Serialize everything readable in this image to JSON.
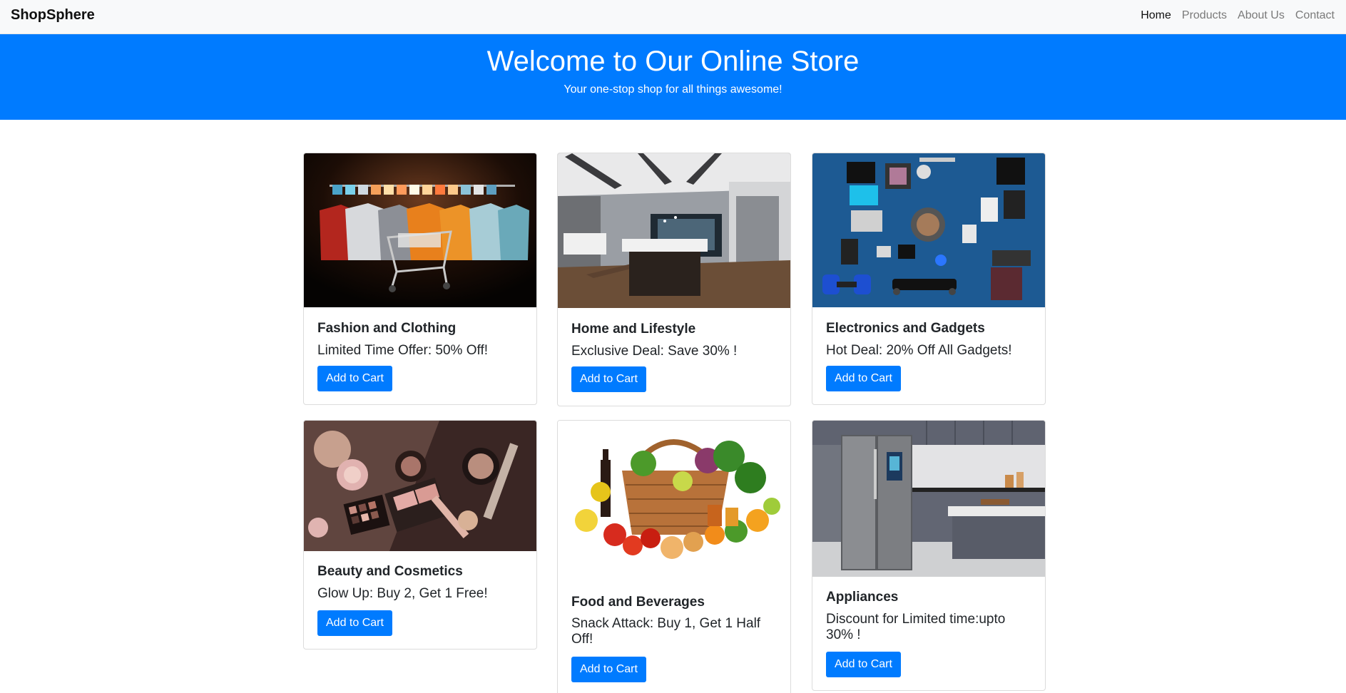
{
  "nav": {
    "brand": "ShopSphere",
    "links": [
      {
        "label": "Home",
        "active": true
      },
      {
        "label": "Products",
        "active": false
      },
      {
        "label": "About Us",
        "active": false
      },
      {
        "label": "Contact",
        "active": false
      }
    ]
  },
  "hero": {
    "title": "Welcome to Our Online Store",
    "subtitle": "Your one-stop shop for all things awesome!"
  },
  "products": [
    {
      "title": "Fashion and Clothing",
      "offer": "Limited Time Offer: 50% Off!",
      "button": "Add to Cart",
      "image": "clothing-rack-with-shopping-cart"
    },
    {
      "title": "Home and Lifestyle",
      "offer": "Exclusive Deal: Save 30% !",
      "button": "Add to Cart",
      "image": "modern-kitchen-interior"
    },
    {
      "title": "Electronics and Gadgets",
      "offer": "Hot Deal: 20% Off All Gadgets!",
      "button": "Add to Cart",
      "image": "gadgets-flat-lay"
    },
    {
      "title": "Beauty and Cosmetics",
      "offer": "Glow Up: Buy 2, Get 1 Free!",
      "button": "Add to Cart",
      "image": "makeup-products-flat-lay"
    },
    {
      "title": "Food and Beverages",
      "offer": "Snack Attack: Buy 1, Get 1 Half Off!",
      "button": "Add to Cart",
      "image": "grocery-basket"
    },
    {
      "title": "Appliances",
      "offer": "Discount for Limited time:upto 30% !",
      "button": "Add to Cart",
      "image": "refrigerator-kitchen"
    }
  ],
  "colors": {
    "primary": "#007bff",
    "navbar_bg": "#f8f9fa",
    "text": "#212529",
    "nav_muted": "#7a7a7a"
  }
}
